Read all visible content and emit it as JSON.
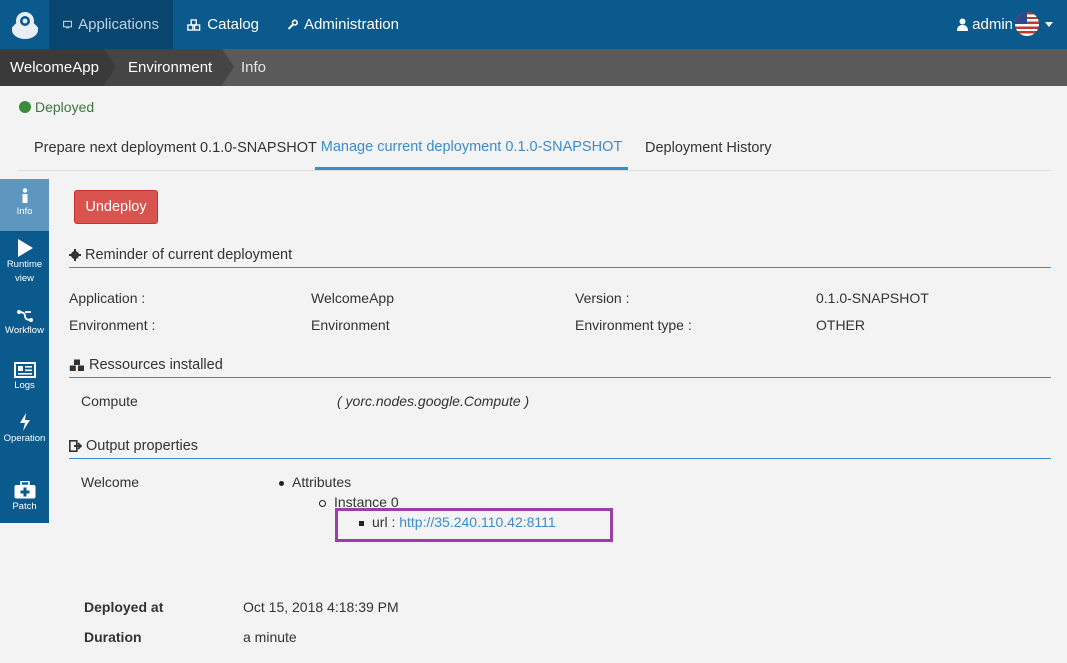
{
  "topbar": {
    "nav": [
      {
        "label": "Applications",
        "active": true,
        "icon": "monitor-icon"
      },
      {
        "label": "Catalog",
        "active": false,
        "icon": "cubes-icon"
      },
      {
        "label": "Administration",
        "active": false,
        "icon": "wrench-icon"
      }
    ],
    "user_label": "admin",
    "language_flag": "us-flag-icon"
  },
  "breadcrumb": [
    "WelcomeApp",
    "Environment",
    "Info"
  ],
  "status": {
    "label": "Deployed",
    "color": "#3a8c3a"
  },
  "tabs": [
    {
      "label": "Prepare next deployment 0.1.0-SNAPSHOT",
      "active": false
    },
    {
      "label": "Manage current deployment 0.1.0-SNAPSHOT",
      "active": true
    },
    {
      "label": "Deployment History",
      "active": false
    }
  ],
  "sidemenu": [
    {
      "label": "Info",
      "icon": "info-icon",
      "active": true
    },
    {
      "label": "Runtime view",
      "icon": "play-icon",
      "active": false
    },
    {
      "label": "Workflow",
      "icon": "workflow-icon",
      "active": false
    },
    {
      "label": "Logs",
      "icon": "logs-icon",
      "active": false
    },
    {
      "label": "Operation",
      "icon": "bolt-icon",
      "active": false
    },
    {
      "label": "Patch",
      "icon": "medkit-icon",
      "active": false
    }
  ],
  "actions": {
    "undeploy_label": "Undeploy"
  },
  "reminder": {
    "title": "Reminder of current deployment",
    "application_label": "Application :",
    "application_value": "WelcomeApp",
    "environment_label": "Environment :",
    "environment_value": "Environment",
    "version_label": "Version :",
    "version_value": "0.1.0-SNAPSHOT",
    "env_type_label": "Environment type :",
    "env_type_value": "OTHER"
  },
  "resources": {
    "title": "Ressources installed",
    "items": [
      {
        "name": "Compute",
        "type": "( yorc.nodes.google.Compute )"
      }
    ]
  },
  "outputs": {
    "title": "Output properties",
    "node": "Welcome",
    "attributes_label": "Attributes",
    "instance_label": "Instance 0",
    "url_label": "url :",
    "url_value": "http://35.240.110.42:8111"
  },
  "deployment_info": {
    "deployed_at_label": "Deployed at",
    "deployed_at_value": "Oct 15, 2018 4:18:39 PM",
    "duration_label": "Duration",
    "duration_value": "a minute"
  },
  "colors": {
    "navbar": "#0b5a8e",
    "accent": "#3d8bc8",
    "danger": "#d9534f",
    "highlight": "#9b3fa8"
  }
}
